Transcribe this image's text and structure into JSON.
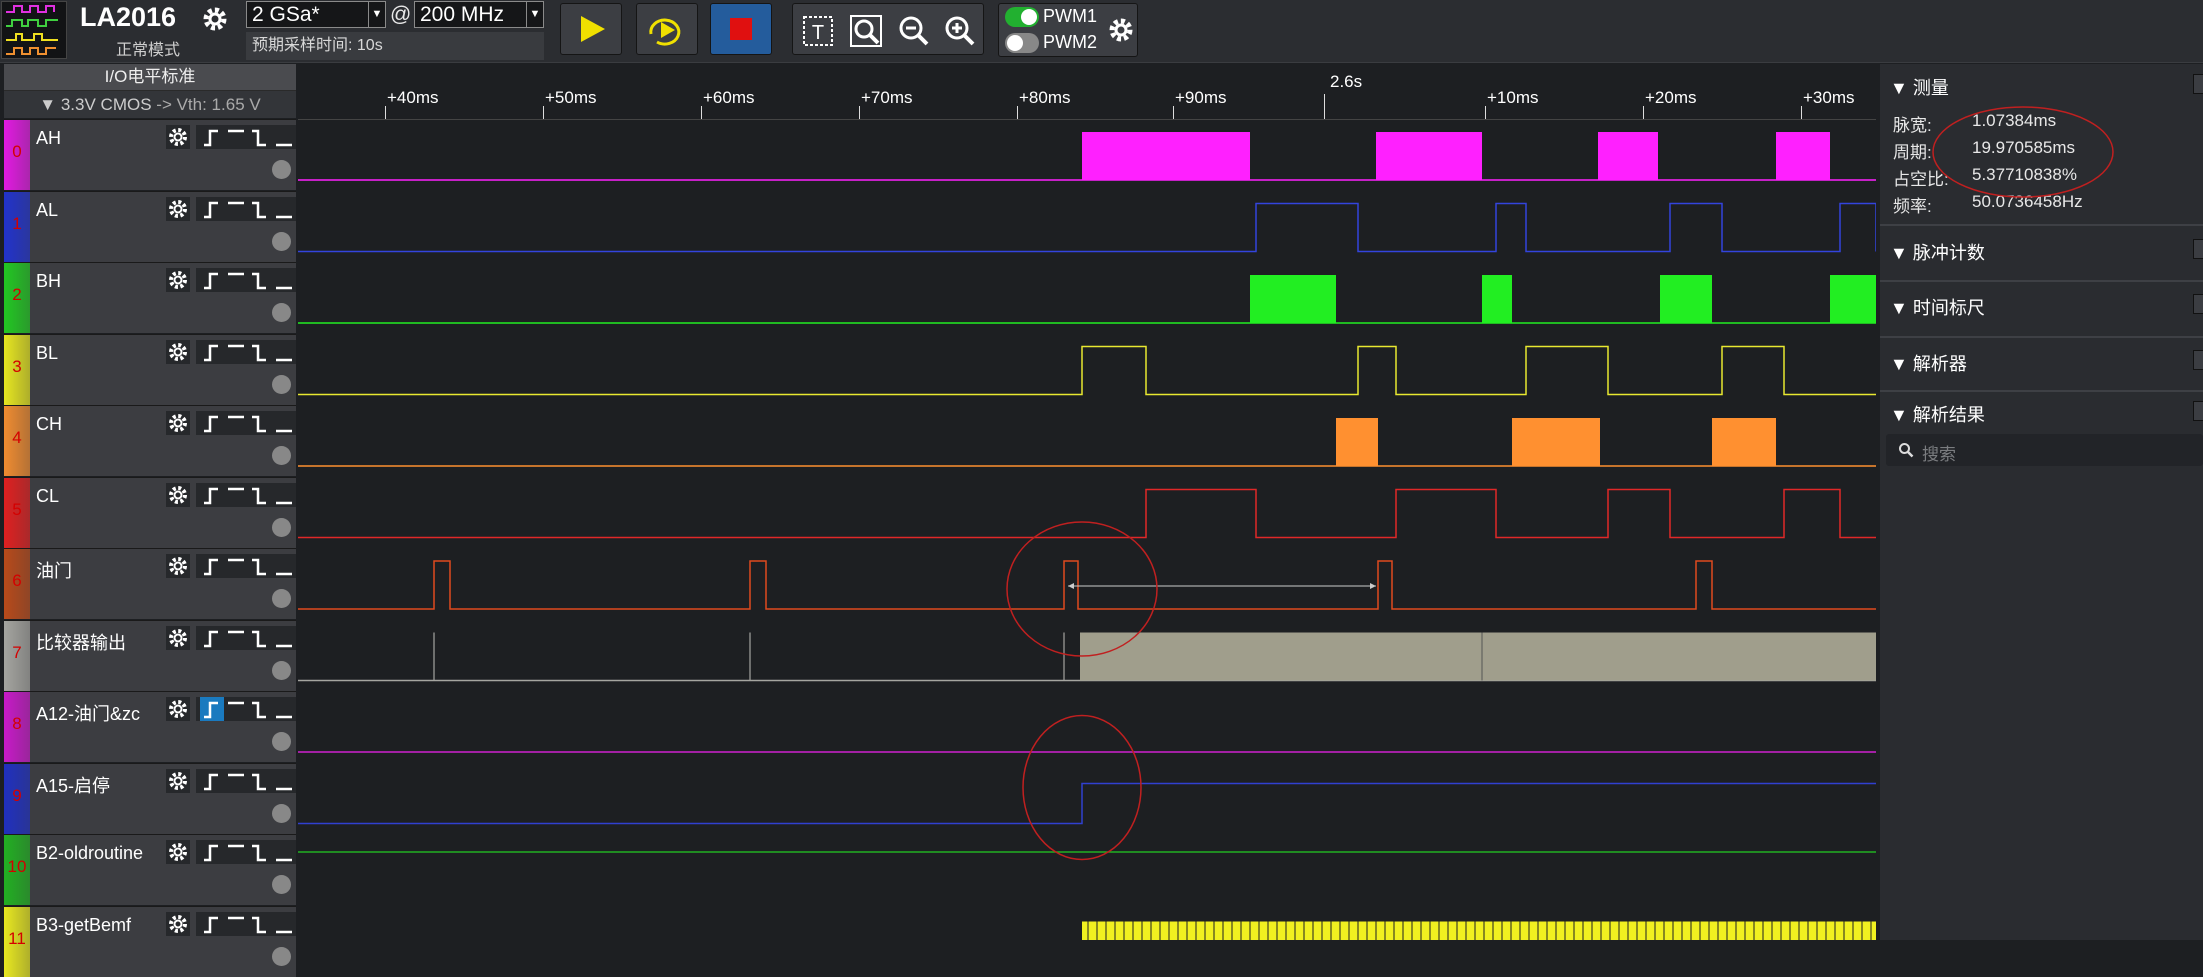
{
  "toolbar": {
    "app_name": "LA2016",
    "mode": "正常模式",
    "sample_rate": "2 GSa*",
    "at": "@",
    "sample_freq": "200 MHz",
    "pretrigger": "预期采样时间: 10s",
    "pwm1": "PWM1",
    "pwm2": "PWM2",
    "pwm1_on": true,
    "pwm2_on": false,
    "run_color": "#f0e000",
    "stop_color": "#e01010"
  },
  "left_panel": {
    "title": "I/O电平标准",
    "io_standard": "3.3V CMOS",
    "vth": "-> Vth: 1.65 V"
  },
  "channels": [
    {
      "num": "0",
      "name": "AH",
      "color": "#e21ae2"
    },
    {
      "num": "1",
      "name": "AL",
      "color": "#2233cc"
    },
    {
      "num": "2",
      "name": "BH",
      "color": "#22c822"
    },
    {
      "num": "3",
      "name": "BL",
      "color": "#e6e620"
    },
    {
      "num": "4",
      "name": "CH",
      "color": "#f08c30"
    },
    {
      "num": "5",
      "name": "CL",
      "color": "#e02020"
    },
    {
      "num": "6",
      "name": "油门",
      "color": "#b84a1a"
    },
    {
      "num": "7",
      "name": "比较器输出",
      "color": "#a5a5a0"
    },
    {
      "num": "8",
      "name": "A12-油门&zc",
      "color": "#c81ac8"
    },
    {
      "num": "9",
      "name": "A15-启停",
      "color": "#2030c0"
    },
    {
      "num": "10",
      "name": "B2-oldroutine",
      "color": "#22b022"
    },
    {
      "num": "11",
      "name": "B3-getBemf",
      "color": "#e8e820"
    }
  ],
  "timeline": {
    "ticks": [
      "+40ms",
      "+50ms",
      "+60ms",
      "+70ms",
      "+80ms",
      "+90ms",
      "2.6s",
      "+10ms",
      "+20ms",
      "+30ms"
    ]
  },
  "right_panel": {
    "measure_title": "测量",
    "measurements": [
      {
        "key": "脉宽:",
        "value": "1.07384ms"
      },
      {
        "key": "周期:",
        "value": "19.970585ms"
      },
      {
        "key": "占空比:",
        "value": "5.37710838%"
      },
      {
        "key": "频率:",
        "value": "50.0736458Hz"
      }
    ],
    "sections": [
      "脉冲计数",
      "时间标尺",
      "解析器",
      "解析结果"
    ],
    "search_placeholder": "搜索"
  }
}
